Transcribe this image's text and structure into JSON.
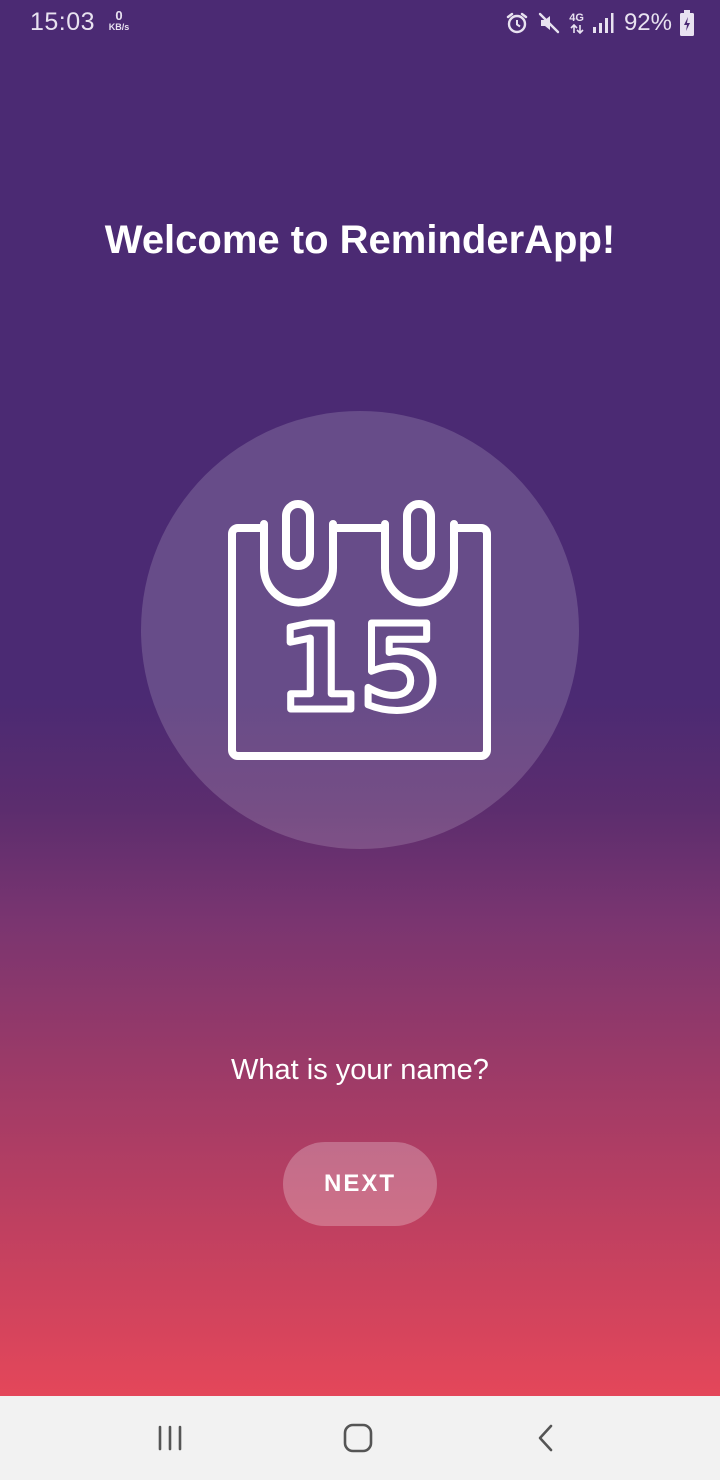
{
  "status_bar": {
    "time": "15:03",
    "net_speed_value": "0",
    "net_speed_unit": "KB/s",
    "network_type": "4G",
    "battery_percent": "92%",
    "icons": [
      "alarm-icon",
      "mute-icon",
      "network-4g-icon",
      "signal-icon",
      "battery-charging-icon"
    ]
  },
  "welcome": {
    "title": "Welcome to ReminderApp!",
    "calendar_day": "15",
    "prompt": "What is your name?",
    "next_label": "NEXT"
  },
  "colors": {
    "gradient_top": "#4b2a73",
    "gradient_bottom": "#e4475a",
    "text": "#ffffff",
    "nav_bar_bg": "#f2f2f2"
  },
  "nav_bar": {
    "icons": [
      "recent-apps-icon",
      "home-icon",
      "back-icon"
    ]
  }
}
